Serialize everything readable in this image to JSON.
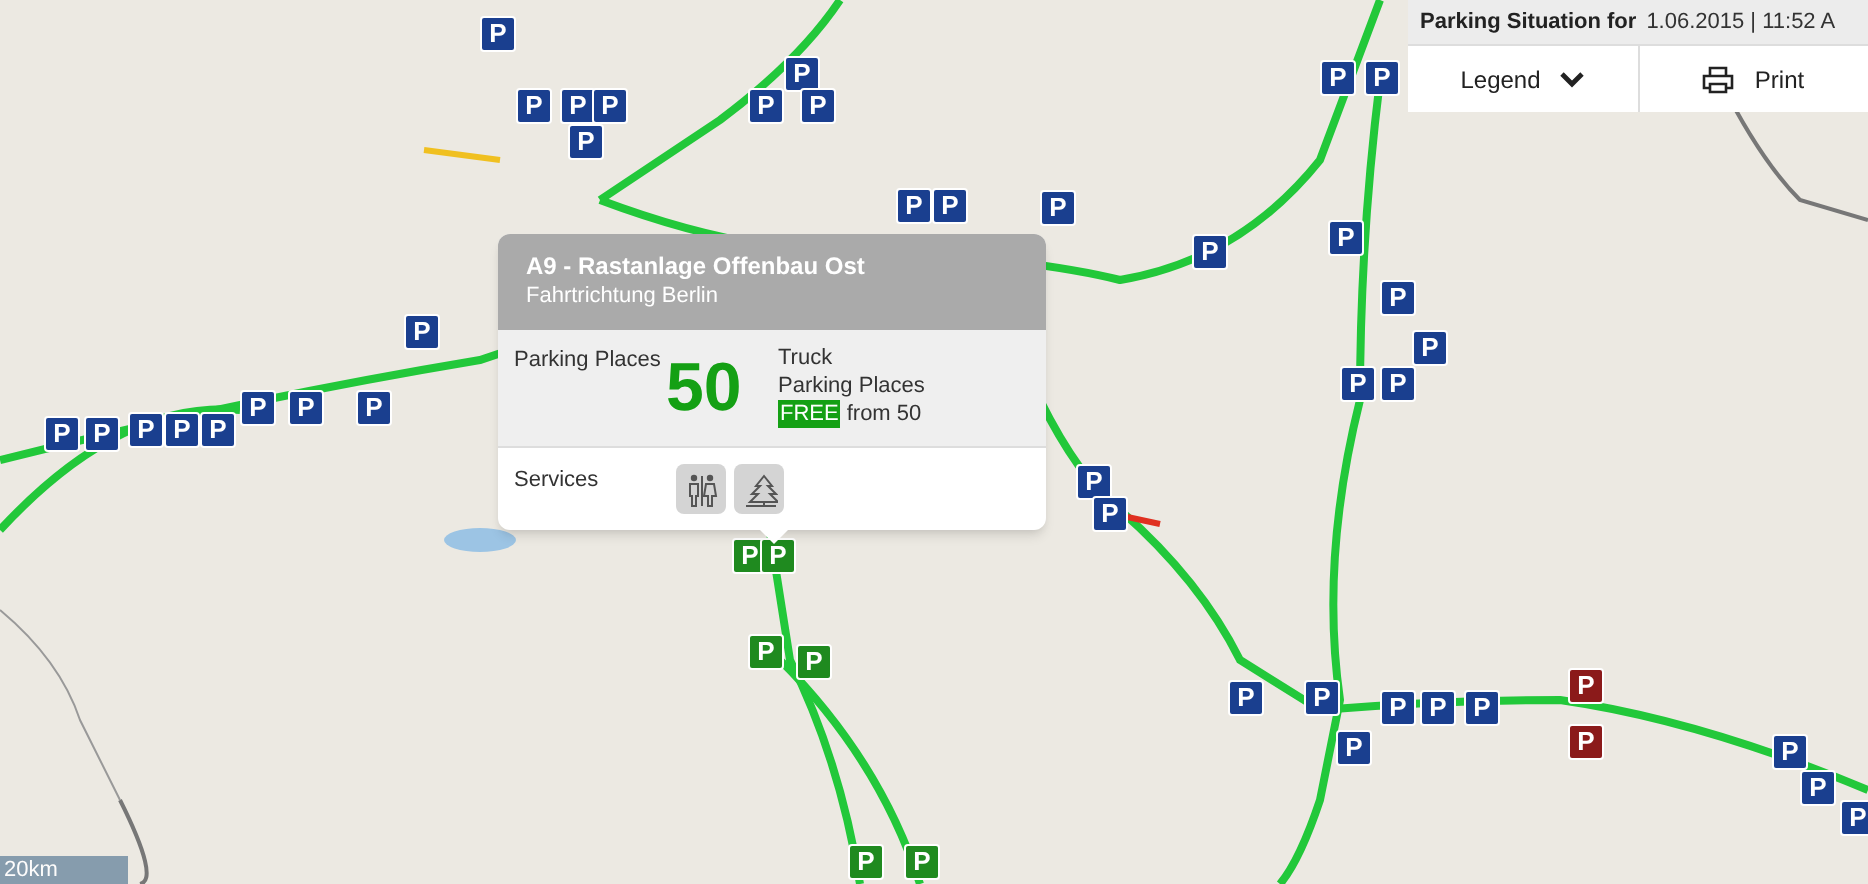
{
  "header": {
    "title": "Parking Situation for",
    "datetime": "1.06.2015 | 11:52 A"
  },
  "toolbar": [
    {
      "label": "Legend",
      "kind": "dropdown"
    },
    {
      "label": "Print",
      "kind": "print"
    }
  ],
  "popup": {
    "title": "A9 - Rastanlage Offenbau Ost",
    "subtitle": "Fahrtrichtung Berlin",
    "places_label": "Parking Places",
    "count": "50",
    "vehicle": "Truck",
    "places_text": "Parking Places",
    "free_badge": "FREE",
    "free_text": "from 50",
    "services_label": "Services",
    "services": [
      {
        "kind": "toilet"
      },
      {
        "kind": "trees"
      }
    ]
  },
  "markers": [
    {
      "label": "P",
      "color": "#1a3f8f"
    },
    {
      "label": "P",
      "color": "#1a3f8f"
    },
    {
      "label": "P",
      "color": "#1a3f8f"
    },
    {
      "label": "P",
      "color": "#1a3f8f"
    },
    {
      "label": "P",
      "color": "#1a3f8f"
    },
    {
      "label": "P",
      "color": "#1a3f8f"
    },
    {
      "label": "P",
      "color": "#1a3f8f"
    },
    {
      "label": "P",
      "color": "#1a3f8f"
    },
    {
      "label": "P",
      "color": "#1a3f8f"
    },
    {
      "label": "P",
      "color": "#1a3f8f"
    },
    {
      "label": "P",
      "color": "#1a3f8f"
    },
    {
      "label": "P",
      "color": "#1a3f8f"
    },
    {
      "label": "P",
      "color": "#1a3f8f"
    },
    {
      "label": "P",
      "color": "#1a3f8f"
    },
    {
      "label": "P",
      "color": "#1a3f8f"
    },
    {
      "label": "P",
      "color": "#1a3f8f"
    },
    {
      "label": "P",
      "color": "#1a3f8f"
    },
    {
      "label": "P",
      "color": "#1a3f8f"
    },
    {
      "label": "P",
      "color": "#1a3f8f"
    },
    {
      "label": "P",
      "color": "#1a3f8f"
    },
    {
      "label": "P",
      "color": "#1a3f8f"
    },
    {
      "label": "P",
      "color": "#1a3f8f"
    },
    {
      "label": "P",
      "color": "#1a3f8f"
    },
    {
      "label": "P",
      "color": "#1a3f8f"
    },
    {
      "label": "P",
      "color": "#1a3f8f"
    },
    {
      "label": "P",
      "color": "#1a3f8f"
    },
    {
      "label": "P",
      "color": "#1a3f8f"
    },
    {
      "label": "P",
      "color": "#1a3f8f"
    },
    {
      "label": "P",
      "color": "#1a3f8f"
    },
    {
      "label": "P",
      "color": "#1a3f8f"
    },
    {
      "label": "P",
      "color": "#1a3f8f"
    },
    {
      "label": "P",
      "color": "#1a3f8f"
    },
    {
      "label": "P",
      "color": "#1a3f8f"
    },
    {
      "label": "P",
      "color": "#1a3f8f"
    },
    {
      "label": "P",
      "color": "#1a3f8f"
    },
    {
      "label": "P",
      "color": "#1a3f8f"
    },
    {
      "label": "P",
      "color": "#1a3f8f"
    },
    {
      "label": "P",
      "color": "#1a3f8f"
    },
    {
      "label": "P",
      "color": "#1a3f8f"
    },
    {
      "label": "P",
      "color": "#1f8a1f"
    },
    {
      "label": "P",
      "color": "#1f8a1f"
    },
    {
      "label": "P",
      "color": "#1f8a1f"
    },
    {
      "label": "P",
      "color": "#1f8a1f"
    },
    {
      "label": "P",
      "color": "#1f8a1f"
    },
    {
      "label": "P",
      "color": "#1f8a1f"
    },
    {
      "label": "P",
      "color": "#8b1a1a"
    },
    {
      "label": "P",
      "color": "#8b1a1a"
    }
  ],
  "scale_bar": {
    "label": "20km"
  }
}
